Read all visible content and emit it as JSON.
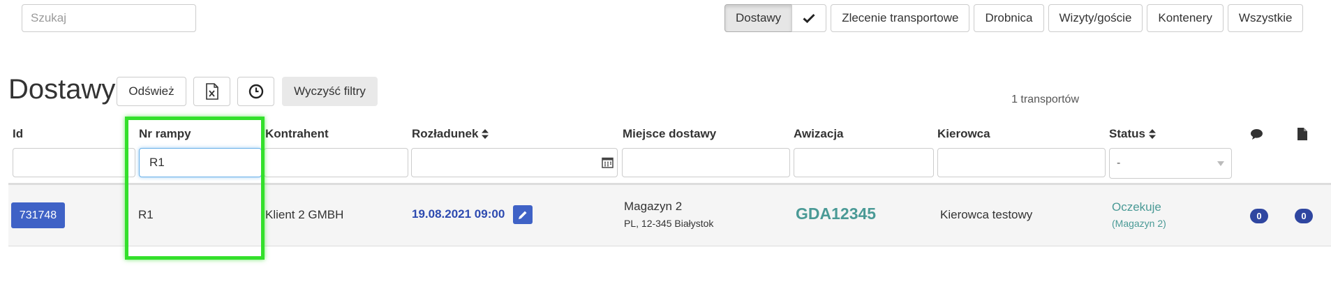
{
  "search": {
    "placeholder": "Szukaj",
    "value": ""
  },
  "type_tabs": {
    "dostawy": "Dostawy",
    "checkmark_icon": "check-icon",
    "zlecenie": "Zlecenie transportowe",
    "drobnica": "Drobnica",
    "wizyty": "Wizyty/goście",
    "kontenery": "Kontenery",
    "wszystkie": "Wszystkie"
  },
  "page": {
    "title": "Dostawy",
    "refresh_label": "Odśwież",
    "excel_icon": "excel-icon",
    "history_icon": "clock-icon",
    "clear_filters_label": "Wyczyść filtry",
    "count_text": "1 transportów"
  },
  "table": {
    "headers": {
      "id": "Id",
      "ramp": "Nr rampy",
      "contractor": "Kontrahent",
      "unloading": "Rozładunek",
      "place": "Miejsce dostawy",
      "notice": "Awizacja",
      "driver": "Kierowca",
      "status": "Status",
      "comments_icon": "comment-icon",
      "documents_icon": "document-icon"
    },
    "filters": {
      "id": "",
      "ramp": "R1",
      "contractor": "",
      "unloading": "",
      "place": "",
      "notice": "",
      "driver": "",
      "status": "-"
    },
    "rows": [
      {
        "id": "731748",
        "ramp": "R1",
        "contractor": "Klient 2 GMBH",
        "unloading": "19.08.2021 09:00",
        "place_name": "Magazyn 2",
        "place_address": "PL, 12-345 Białystok",
        "notice": "GDA12345",
        "driver": "Kierowca testowy",
        "status": "Oczekuje",
        "status_detail": "(Magazyn 2)",
        "comments": "0",
        "documents": "0"
      }
    ]
  },
  "colors": {
    "primary": "#3f62c6",
    "teal": "#4a9a96",
    "highlight": "#33e02b",
    "badge": "#2f46a0"
  }
}
